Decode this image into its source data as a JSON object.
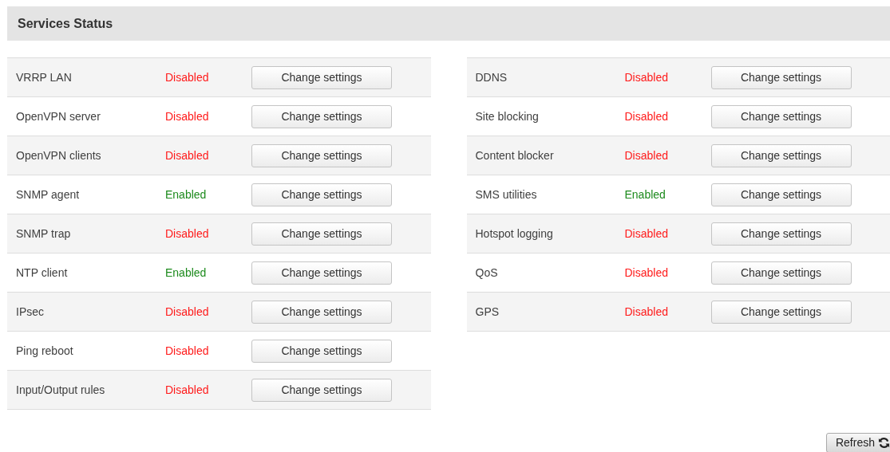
{
  "title": "Services Status",
  "columns": [
    [
      {
        "name": "VRRP LAN",
        "status": "Disabled",
        "enabled": false,
        "button": "Change settings"
      },
      {
        "name": "OpenVPN server",
        "status": "Disabled",
        "enabled": false,
        "button": "Change settings"
      },
      {
        "name": "OpenVPN clients",
        "status": "Disabled",
        "enabled": false,
        "button": "Change settings"
      },
      {
        "name": "SNMP agent",
        "status": "Enabled",
        "enabled": true,
        "button": "Change settings"
      },
      {
        "name": "SNMP trap",
        "status": "Disabled",
        "enabled": false,
        "button": "Change settings"
      },
      {
        "name": "NTP client",
        "status": "Enabled",
        "enabled": true,
        "button": "Change settings"
      },
      {
        "name": "IPsec",
        "status": "Disabled",
        "enabled": false,
        "button": "Change settings"
      },
      {
        "name": "Ping reboot",
        "status": "Disabled",
        "enabled": false,
        "button": "Change settings"
      },
      {
        "name": "Input/Output rules",
        "status": "Disabled",
        "enabled": false,
        "button": "Change settings"
      }
    ],
    [
      {
        "name": "DDNS",
        "status": "Disabled",
        "enabled": false,
        "button": "Change settings"
      },
      {
        "name": "Site blocking",
        "status": "Disabled",
        "enabled": false,
        "button": "Change settings"
      },
      {
        "name": "Content blocker",
        "status": "Disabled",
        "enabled": false,
        "button": "Change settings"
      },
      {
        "name": "SMS utilities",
        "status": "Enabled",
        "enabled": true,
        "button": "Change settings"
      },
      {
        "name": "Hotspot logging",
        "status": "Disabled",
        "enabled": false,
        "button": "Change settings"
      },
      {
        "name": "QoS",
        "status": "Disabled",
        "enabled": false,
        "button": "Change settings"
      },
      {
        "name": "GPS",
        "status": "Disabled",
        "enabled": false,
        "button": "Change settings"
      }
    ]
  ],
  "refresh_button": "Refresh"
}
